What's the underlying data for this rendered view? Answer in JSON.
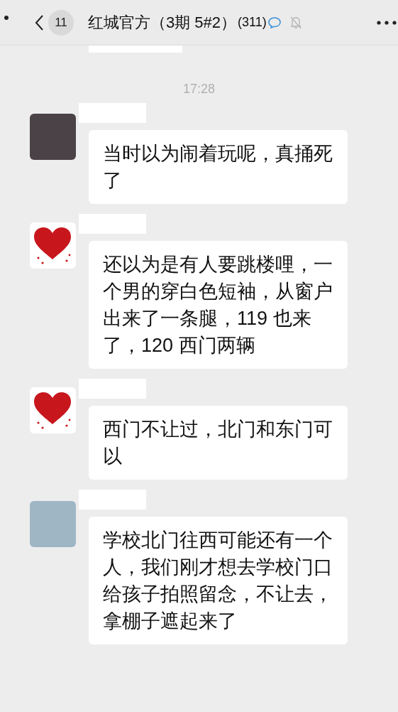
{
  "header": {
    "unread_count": "11",
    "title": "红城官方（3期 5#2）",
    "member_count": "(311)"
  },
  "timestamp": "17:28",
  "messages": [
    {
      "kind": "dark",
      "text": "当时以为闹着玩呢，真捅死了"
    },
    {
      "kind": "heart",
      "text": "还以为是有人要跳楼哩，一个男的穿白色短袖，从窗户出来了一条腿，119 也来了，120 西门两辆"
    },
    {
      "kind": "heart",
      "text": "西门不让过，北门和东门可以"
    },
    {
      "kind": "photo",
      "text": "学校北门往西可能还有一个人，我们刚才想去学校门口给孩子拍照留念，不让去，拿棚子遮起来了"
    }
  ]
}
